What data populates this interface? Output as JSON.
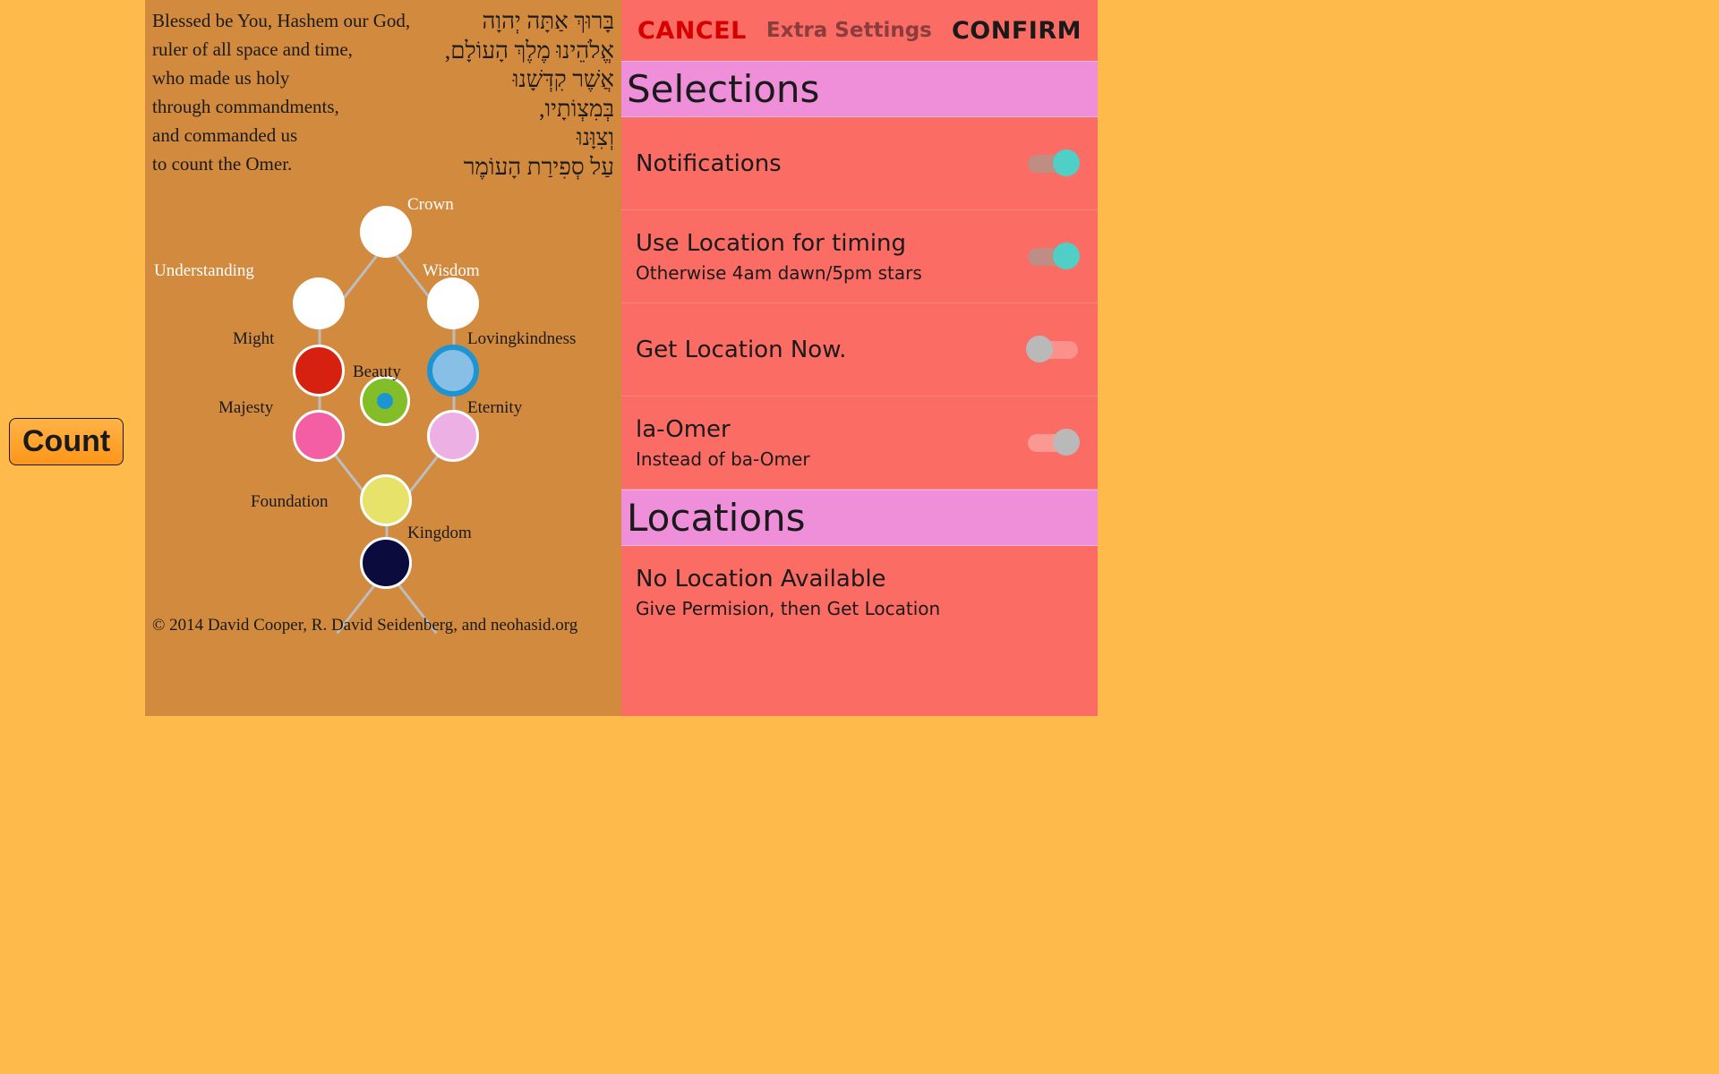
{
  "count_btn": "Count",
  "blessing": {
    "en": "Blessed be You, Hashem our God,\nruler of all space and time,\nwho made us holy\nthrough commandments,\nand commanded us\nto count the Omer.",
    "he": "בָּרוּךְ אַתָּה יְהוָה\nאֱלֹהֵינוּ מֶלֶךְ הָעוֹלָם,\nאֲשֶׁר קִדְּשָׁנוּ\nבְּמִצְוֹתָיו,\nוְצִוָּנוּ\nעַל סְפִירַת הָעוֹמֶר"
  },
  "tree": {
    "crown": "Crown",
    "understanding": "Understanding",
    "wisdom": "Wisdom",
    "might": "Might",
    "lovingkindness": "Lovingkindness",
    "beauty": "Beauty",
    "majesty": "Majesty",
    "eternity": "Eternity",
    "foundation": "Foundation",
    "kingdom": "Kingdom"
  },
  "copyright": "© 2014 David Cooper, R. David Seidenberg, and neohasid.org",
  "dialog": {
    "cancel": "CANCEL",
    "title": "Extra Settings",
    "confirm": "CONFIRM",
    "section1": "Selections",
    "row1": {
      "title": "Notifications",
      "on": true
    },
    "row2": {
      "title": "Use Location for timing",
      "sub": "Otherwise 4am dawn/5pm stars",
      "on": true
    },
    "row3": {
      "title": "Get Location Now.",
      "on": false
    },
    "row4": {
      "title": "la-Omer",
      "sub": "Instead of ba-Omer",
      "on": false
    },
    "section2": "Locations",
    "loc": {
      "title": "No Location Available",
      "sub": "Give Permision, then Get Location"
    }
  }
}
